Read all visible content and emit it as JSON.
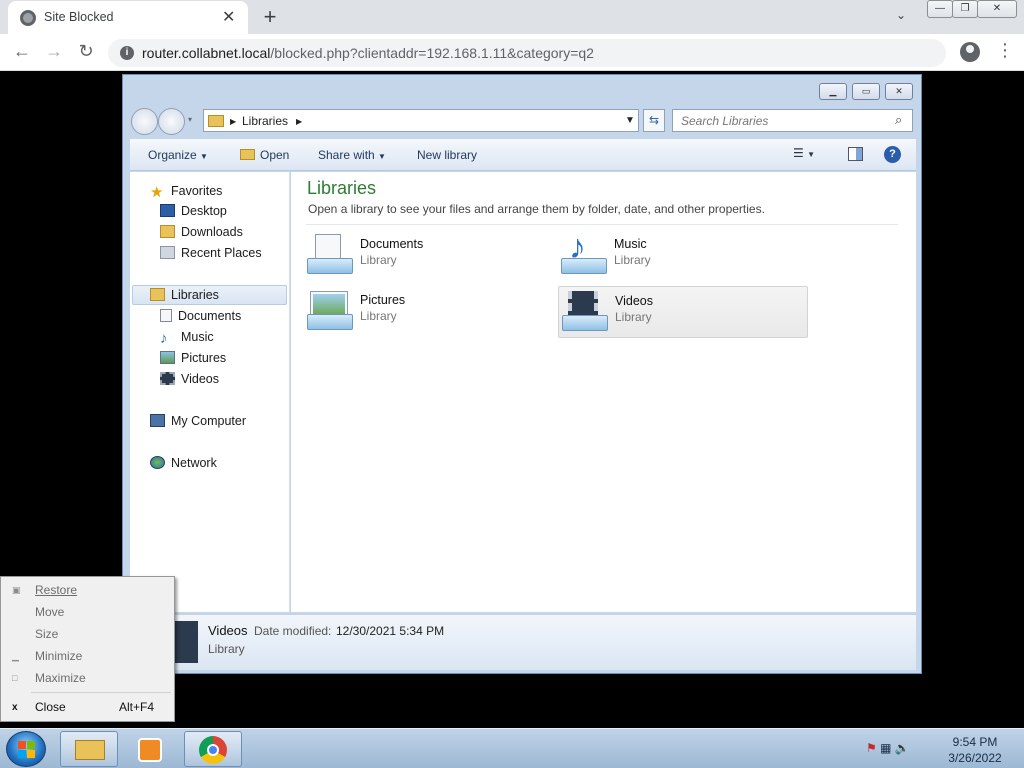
{
  "browser": {
    "tab_title": "Site Blocked",
    "tab_close": "✕",
    "new_tab": "+",
    "tab_dropdown": "⌄",
    "win_min": "—",
    "win_restore": "❐",
    "win_close": "✕",
    "back": "←",
    "forward": "→",
    "reload": "↻",
    "url_host": "router.collabnet.local",
    "url_path": "/blocked.php?clientaddr=192.168.1.11&category=q2",
    "kebab": "⋮"
  },
  "explorer": {
    "ctrl": {
      "min": "▁",
      "max": "▭",
      "close": "✕"
    },
    "address": {
      "crumb": "Libraries"
    },
    "search_placeholder": "Search Libraries",
    "toolbar": {
      "organize": "Organize",
      "open": "Open",
      "share_with": "Share with",
      "new_library": "New library"
    },
    "nav": {
      "favorites": "Favorites",
      "desktop": "Desktop",
      "downloads": "Downloads",
      "recent_places": "Recent Places",
      "libraries": "Libraries",
      "documents": "Documents",
      "music": "Music",
      "pictures": "Pictures",
      "videos": "Videos",
      "my_computer": "My Computer",
      "network": "Network"
    },
    "content": {
      "title": "Libraries",
      "subtitle": "Open a library to see your files and arrange them by folder, date, and other properties.",
      "items": [
        {
          "name": "Documents",
          "type": "Library"
        },
        {
          "name": "Music",
          "type": "Library"
        },
        {
          "name": "Pictures",
          "type": "Library"
        },
        {
          "name": "Videos",
          "type": "Library"
        }
      ]
    },
    "details": {
      "name": "Videos",
      "modified_label": "Date modified:",
      "modified_value": "12/30/2021 5:34 PM",
      "type": "Library"
    }
  },
  "context_menu": {
    "restore": "Restore",
    "move": "Move",
    "size": "Size",
    "minimize": "Minimize",
    "maximize": "Maximize",
    "close": "Close",
    "close_accel": "Alt+F4"
  },
  "taskbar": {
    "time": "9:54 PM",
    "date": "3/26/2022"
  },
  "colors": {
    "library_title": "#2e7d32",
    "taskbar": "#9db8d4"
  }
}
